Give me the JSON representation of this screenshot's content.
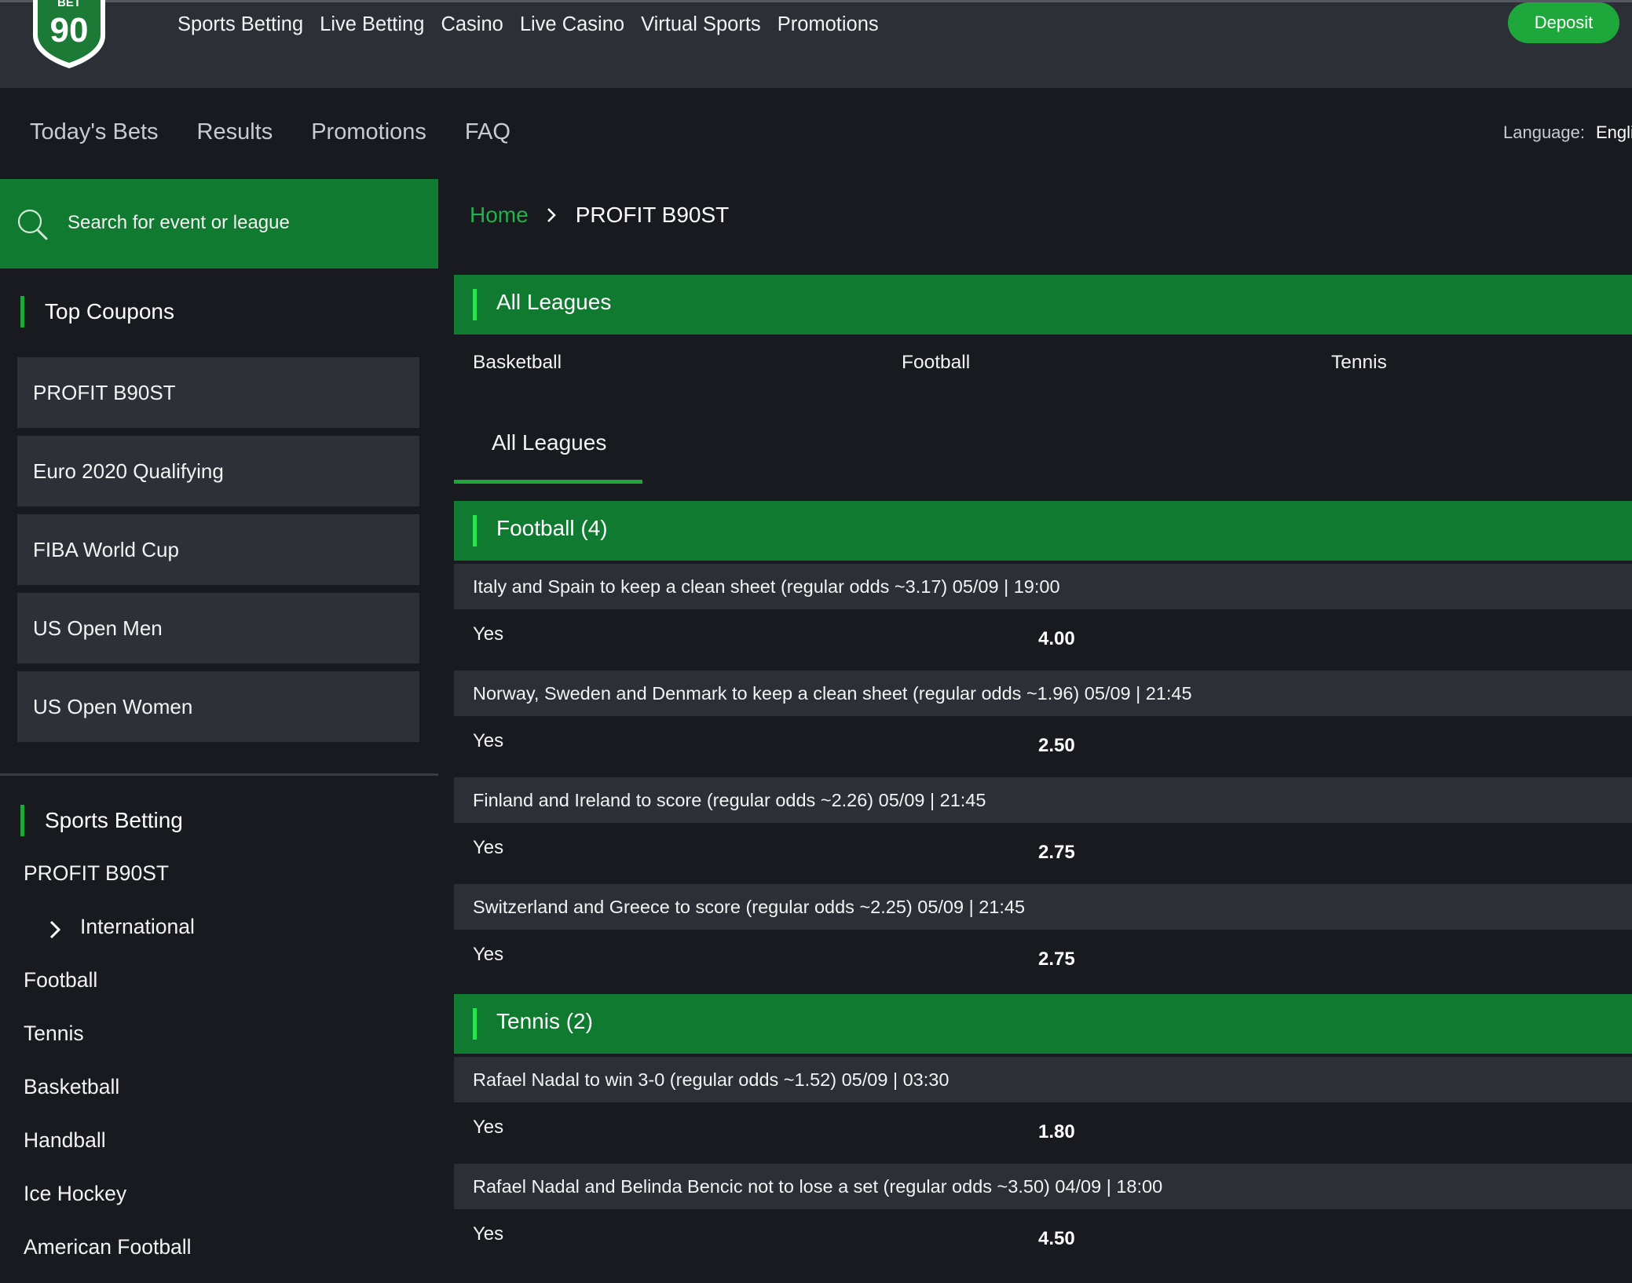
{
  "brand": {
    "logo_text_top": "BET",
    "logo_text_main": "90",
    "accent": "#1ea83c",
    "band": "#117a31"
  },
  "top_nav": [
    "Sports Betting",
    "Live Betting",
    "Casino",
    "Live Casino",
    "Virtual Sports",
    "Promotions"
  ],
  "deposit_label": "Deposit",
  "sub_nav": [
    "Today's Bets",
    "Results",
    "Promotions",
    "FAQ"
  ],
  "language": {
    "label": "Language:",
    "value": "Engli"
  },
  "search": {
    "placeholder": "Search for event or league",
    "icon": "search-icon"
  },
  "sidebar": {
    "top_coupons_title": "Top Coupons",
    "coupons": [
      "PROFIT B90ST",
      "Euro 2020 Qualifying",
      "FIBA World Cup",
      "US Open Men",
      "US Open Women"
    ],
    "sports_title": "Sports Betting",
    "sports_items": [
      "PROFIT B90ST",
      "International",
      "Football",
      "Tennis",
      "Basketball",
      "Handball",
      "Ice Hockey",
      "American Football"
    ]
  },
  "breadcrumb": {
    "home": "Home",
    "current": "PROFIT B90ST"
  },
  "all_leagues_header": "All Leagues",
  "sport_tabs": [
    "Basketball",
    "Football",
    "Tennis"
  ],
  "league_tab": "All Leagues",
  "groups": [
    {
      "title": "Football (4)",
      "events": [
        {
          "name": "Italy and Spain to keep a clean sheet (regular odds ~3.17) 05/09 | 19:00",
          "selection": "Yes",
          "odds": "4.00"
        },
        {
          "name": "Norway, Sweden and Denmark to keep a clean sheet (regular odds ~1.96) 05/09 | 21:45",
          "selection": "Yes",
          "odds": "2.50"
        },
        {
          "name": "Finland and Ireland to score (regular odds ~2.26) 05/09 | 21:45",
          "selection": "Yes",
          "odds": "2.75"
        },
        {
          "name": "Switzerland and Greece to score (regular odds ~2.25) 05/09 | 21:45",
          "selection": "Yes",
          "odds": "2.75"
        }
      ]
    },
    {
      "title": "Tennis (2)",
      "events": [
        {
          "name": "Rafael Nadal to win 3-0 (regular odds ~1.52)  05/09 | 03:30",
          "selection": "Yes",
          "odds": "1.80"
        },
        {
          "name": "Rafael Nadal and Belinda Bencic not to lose a set (regular odds ~3.50) 04/09 | 18:00",
          "selection": "Yes",
          "odds": "4.50"
        }
      ]
    }
  ]
}
